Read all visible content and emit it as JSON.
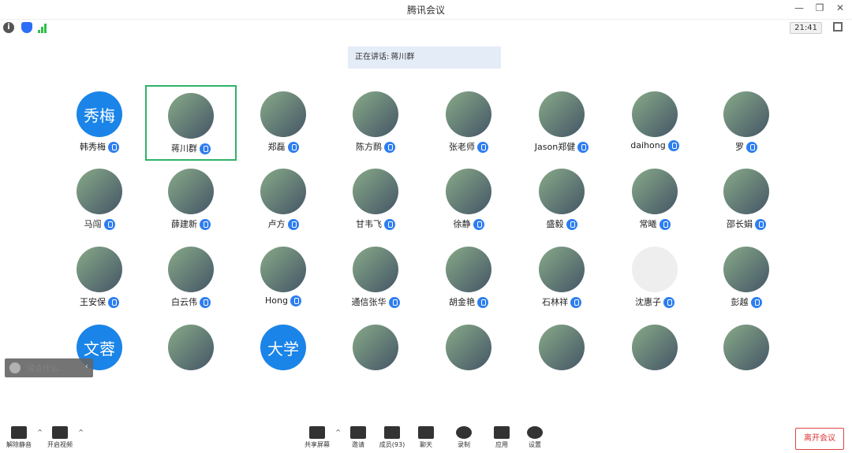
{
  "window": {
    "title": "腾讯会议"
  },
  "status": {
    "time": "21:41"
  },
  "speaking_label": "正在讲话:",
  "speaking_name": "蒋川群",
  "participants": [
    {
      "name": "韩秀梅",
      "avatar_text": "秀梅",
      "avatar_type": "text"
    },
    {
      "name": "蒋川群",
      "avatar_type": "photo",
      "active": true
    },
    {
      "name": "郑磊",
      "avatar_type": "photo"
    },
    {
      "name": "陈方鸸",
      "avatar_type": "photo"
    },
    {
      "name": "张老师",
      "avatar_type": "photo"
    },
    {
      "name": "Jason郑健",
      "avatar_type": "photo"
    },
    {
      "name": "daihong",
      "avatar_type": "photo"
    },
    {
      "name": "罗",
      "avatar_type": "photo"
    },
    {
      "name": "马闯",
      "avatar_type": "photo"
    },
    {
      "name": "薛建新",
      "avatar_type": "photo"
    },
    {
      "name": "卢方",
      "avatar_type": "photo"
    },
    {
      "name": "甘韦飞",
      "avatar_type": "photo"
    },
    {
      "name": "徐静",
      "avatar_type": "photo"
    },
    {
      "name": "盛毅",
      "avatar_type": "photo"
    },
    {
      "name": "常曦",
      "avatar_type": "photo"
    },
    {
      "name": "邵长娟",
      "avatar_type": "photo"
    },
    {
      "name": "王安保",
      "avatar_type": "photo"
    },
    {
      "name": "白云伟",
      "avatar_type": "photo"
    },
    {
      "name": "Hong",
      "avatar_type": "photo"
    },
    {
      "name": "通信张华",
      "avatar_type": "photo"
    },
    {
      "name": "胡金艳",
      "avatar_type": "photo"
    },
    {
      "name": "石林祥",
      "avatar_type": "photo"
    },
    {
      "name": "沈惠子",
      "avatar_type": "default"
    },
    {
      "name": "彭越",
      "avatar_type": "photo"
    },
    {
      "name": "",
      "avatar_text": "文蓉",
      "avatar_type": "text"
    },
    {
      "name": "",
      "avatar_type": "photo"
    },
    {
      "name": "",
      "avatar_text": "大学",
      "avatar_type": "text"
    },
    {
      "name": "",
      "avatar_type": "photo"
    },
    {
      "name": "",
      "avatar_type": "photo"
    },
    {
      "name": "",
      "avatar_type": "photo"
    },
    {
      "name": "",
      "avatar_type": "photo"
    },
    {
      "name": "",
      "avatar_type": "photo"
    }
  ],
  "chat": {
    "placeholder": "说点什么..."
  },
  "toolbar": {
    "unmute": "解除静音",
    "video": "开启视频",
    "share": "共享屏幕",
    "invite": "邀请",
    "members": "成员(93)",
    "chat": "聊天",
    "record": "录制",
    "apps": "应用",
    "settings": "设置",
    "leave": "离开会议"
  }
}
